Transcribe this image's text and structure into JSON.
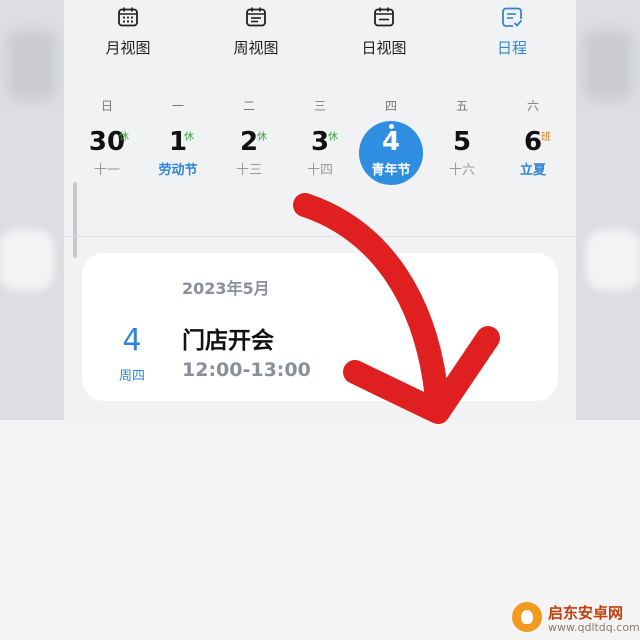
{
  "views": [
    {
      "label": "月视图",
      "icon": "calendar-month-icon"
    },
    {
      "label": "周视图",
      "icon": "calendar-week-icon"
    },
    {
      "label": "日视图",
      "icon": "calendar-day-icon"
    },
    {
      "label": "日程",
      "icon": "schedule-list-icon"
    }
  ],
  "week": [
    {
      "weekday": "日",
      "date": "30",
      "badge": "休",
      "sub": "十一"
    },
    {
      "weekday": "一",
      "date": "1",
      "badge": "休",
      "sub": "劳动节"
    },
    {
      "weekday": "二",
      "date": "2",
      "badge": "休",
      "sub": "十三"
    },
    {
      "weekday": "三",
      "date": "3",
      "badge": "休",
      "sub": "十四"
    },
    {
      "weekday": "四",
      "date": "4",
      "badge": "",
      "sub": "青年节"
    },
    {
      "weekday": "五",
      "date": "5",
      "badge": "",
      "sub": "十六"
    },
    {
      "weekday": "六",
      "date": "6",
      "badge": "班",
      "sub": "立夏"
    }
  ],
  "event": {
    "month": "2023年5月",
    "day": "4",
    "weekday": "周四",
    "title": "门店开会",
    "time": "12:00-13:00"
  },
  "watermark": {
    "name": "启东安卓网",
    "url": "www.qdltdq.com"
  },
  "colors": {
    "accent": "#2f86d6",
    "rest_badge": "#3aa040",
    "work_badge": "#e07a1f",
    "arrow": "#e02020"
  }
}
